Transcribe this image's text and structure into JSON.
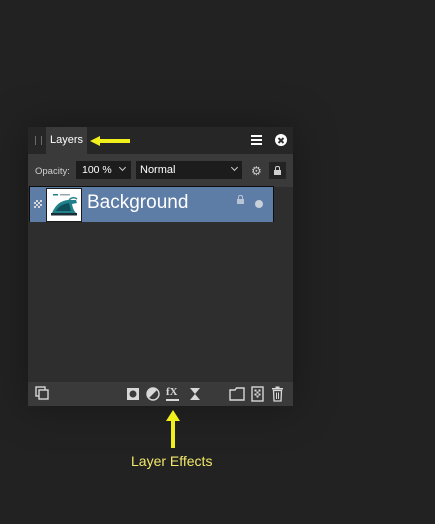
{
  "panel": {
    "tab_label": "Layers",
    "opacity_label": "Opacity:",
    "opacity_value": "100 %",
    "blend_mode": "Normal"
  },
  "layers": [
    {
      "name": "Background",
      "thumbnail": "iron-image",
      "locked": true,
      "visible": true
    }
  ],
  "bottom_toolbar": {
    "icons": [
      "arrange-icon",
      "mask-icon",
      "adjustment-icon",
      "layer-effects-icon",
      "live-filter-icon",
      "group-icon",
      "add-pixel-layer-icon",
      "delete-icon"
    ],
    "fx_glyph": "fX"
  },
  "annotations": {
    "layer_effects_caption": "Layer Effects",
    "arrow_color": "#f2f01c",
    "caption_color": "#f2e86a"
  },
  "colors": {
    "background": "#222222",
    "panel": "#2e2e2e",
    "toolbar": "#3a3a3a",
    "selected_row": "#5d7da7"
  }
}
